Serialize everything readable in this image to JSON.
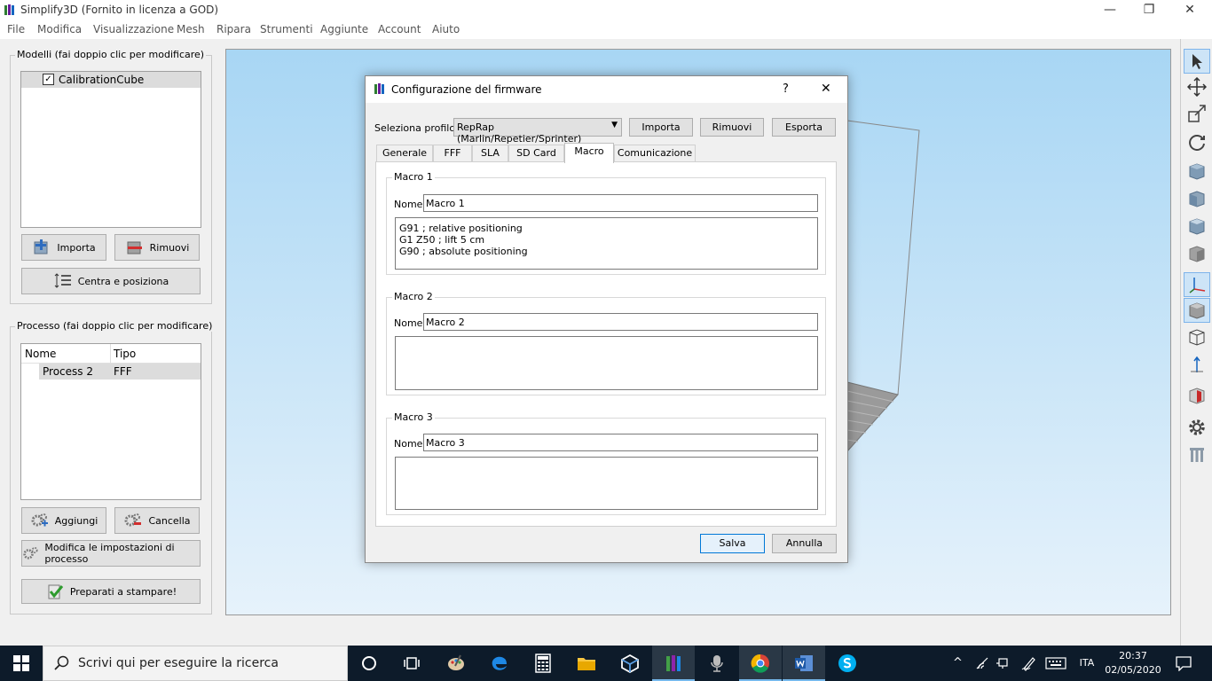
{
  "window": {
    "title": "Simplify3D (Fornito in licenza a GOD)",
    "minimize": "—",
    "restore": "❐",
    "close": "✕"
  },
  "menu": [
    "File",
    "Modifica",
    "Visualizzazione",
    "Mesh",
    "Ripara",
    "Strumenti",
    "Aggiunte",
    "Account",
    "Aiuto"
  ],
  "models_panel": {
    "title": "Modelli (fai doppio clic per modificare)",
    "items": [
      {
        "name": "CalibrationCube",
        "checked": true
      }
    ],
    "import_label": "Importa",
    "remove_label": "Rimuovi",
    "center_label": "Centra e posiziona"
  },
  "process_panel": {
    "title": "Processo (fai doppio clic per modificare)",
    "columns": [
      "Nome",
      "Tipo"
    ],
    "rows": [
      {
        "name": "Process 2",
        "type": "FFF"
      }
    ],
    "add_label": "Aggiungi",
    "delete_label": "Cancella",
    "edit_label": "Modifica le impostazioni di processo",
    "prepare_label": "Preparati a stampare!"
  },
  "dialog": {
    "title": "Configurazione del firmware",
    "help": "?",
    "close": "✕",
    "profile_label": "Seleziona profilo:",
    "profile_value": "RepRap (Marlin/Repetier/Sprinter)",
    "import_label": "Importa",
    "remove_label": "Rimuovi",
    "export_label": "Esporta",
    "tabs": [
      "Generale",
      "FFF",
      "SLA",
      "SD Card",
      "Macro",
      "Comunicazione"
    ],
    "active_tab": "Macro",
    "macros": [
      {
        "title": "Macro 1",
        "name_label": "Nome",
        "name": "Macro 1",
        "code": "G91 ; relative positioning\nG1 Z50 ; lift 5 cm\nG90 ; absolute positioning"
      },
      {
        "title": "Macro 2",
        "name_label": "Nome",
        "name": "Macro 2",
        "code": ""
      },
      {
        "title": "Macro 3",
        "name_label": "Nome",
        "name": "Macro 3",
        "code": ""
      }
    ],
    "save_label": "Salva",
    "cancel_label": "Annulla"
  },
  "taskbar": {
    "search_placeholder": "Scrivi qui per eseguire la ricerca",
    "language": "ITA",
    "time": "20:37",
    "date": "02/05/2020"
  },
  "colors": {
    "accent": "#0078d7",
    "viewport_top": "#a8d6f4",
    "taskbar": "#0d1b2a"
  }
}
